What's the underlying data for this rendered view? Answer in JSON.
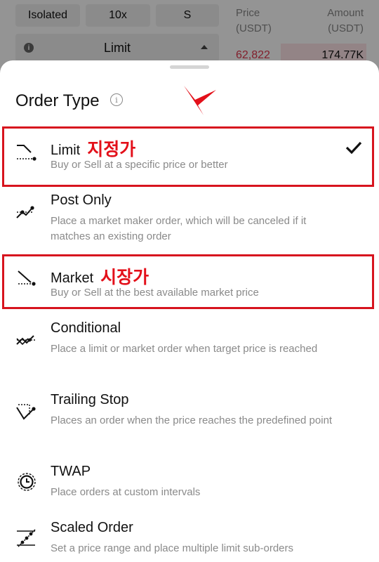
{
  "background": {
    "margin_mode": "Isolated",
    "leverage": "10x",
    "side_short": "S",
    "selected_order_type": "Limit",
    "price_header": "Price\n(USDT)",
    "amount_header": "Amount\n(USDT)",
    "price_header_line1": "Price",
    "price_header_line2": "(USDT)",
    "amount_header_line1": "Amount",
    "amount_header_line2": "(USDT)",
    "ask_price": "62,822",
    "ask_amount": "174.77K"
  },
  "sheet": {
    "title": "Order Type",
    "info_glyph": "i",
    "items": [
      {
        "name": "Limit",
        "annotation": "지정가",
        "desc": "Buy or Sell at a specific price or better",
        "selected": true,
        "icon": "limit-order-icon"
      },
      {
        "name": "Post Only",
        "annotation": "",
        "desc": "Place a market maker order, which will be canceled if it matches an existing order",
        "selected": false,
        "icon": "post-only-icon"
      },
      {
        "name": "Market",
        "annotation": "시장가",
        "desc": "Buy or Sell at the best available market price",
        "selected": false,
        "icon": "market-order-icon"
      },
      {
        "name": "Conditional",
        "annotation": "",
        "desc": "Place a limit or market order when target price is reached",
        "selected": false,
        "icon": "conditional-order-icon"
      },
      {
        "name": "Trailing Stop",
        "annotation": "",
        "desc": "Places an order when the price reaches the predefined point",
        "selected": false,
        "icon": "trailing-stop-icon"
      },
      {
        "name": "TWAP",
        "annotation": "",
        "desc": "Place orders at custom intervals",
        "selected": false,
        "icon": "twap-clock-icon"
      },
      {
        "name": "Scaled Order",
        "annotation": "",
        "desc": "Set a price range and place multiple limit sub-orders",
        "selected": false,
        "icon": "scaled-order-icon"
      }
    ]
  },
  "colors": {
    "annotation_red": "#d7141e",
    "ask_red": "#e0364c",
    "text_secondary": "#8a8a8a"
  }
}
